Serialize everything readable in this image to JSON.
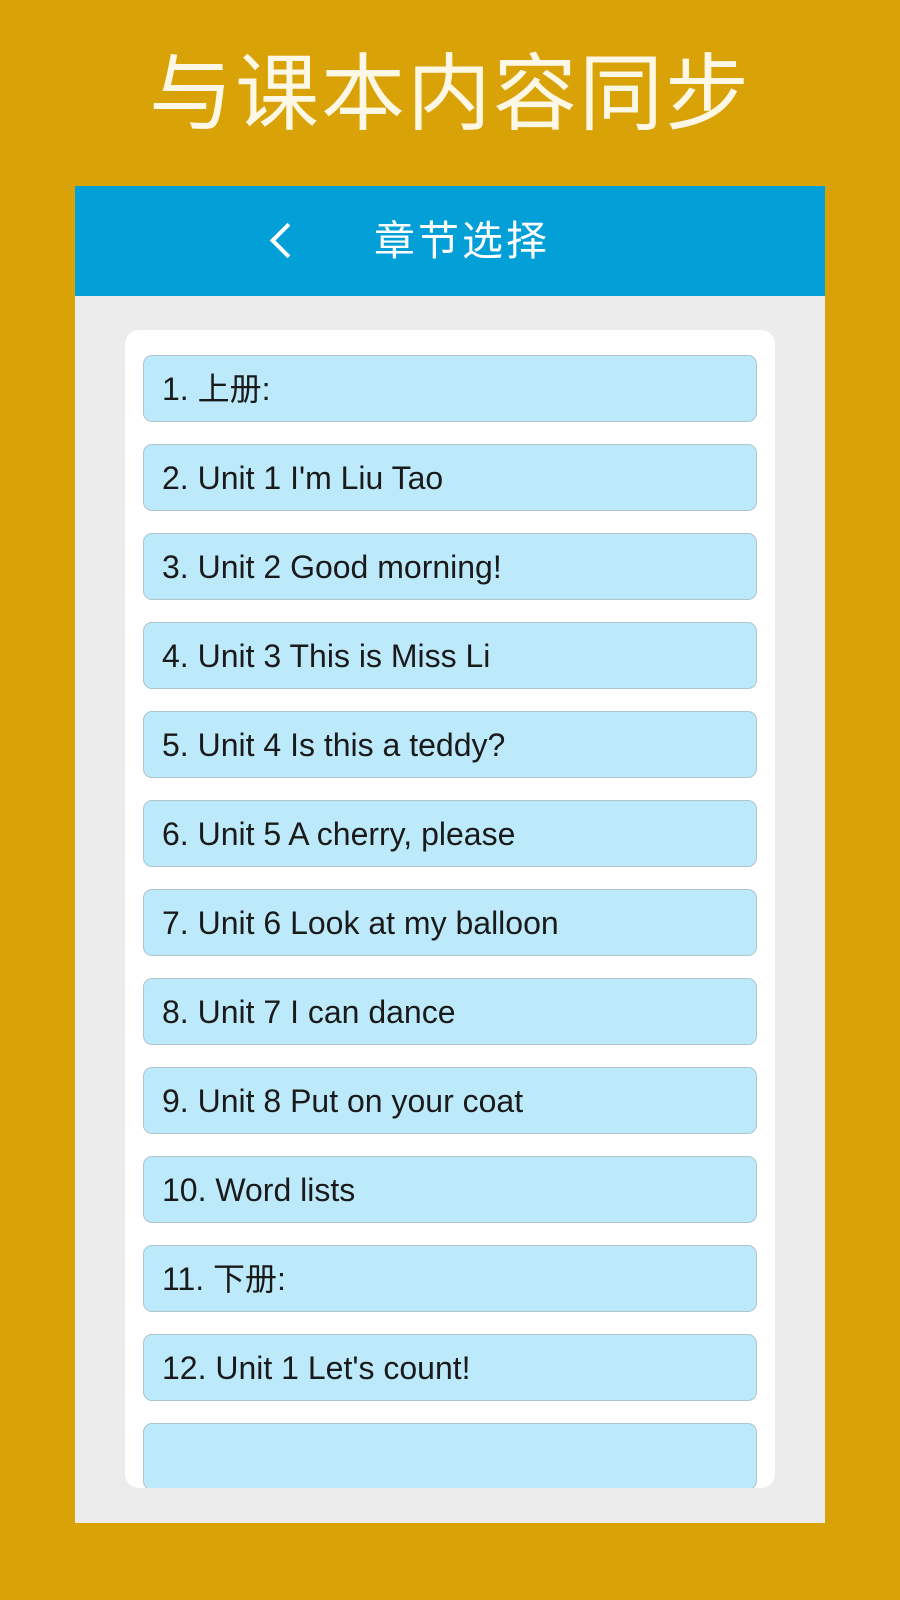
{
  "promo": {
    "headline": "与课本内容同步"
  },
  "app_bar": {
    "back_icon": "chevron-left-icon",
    "title": "章节选择"
  },
  "colors": {
    "promo_background": "#D9A206",
    "promo_text": "#FDF7E6",
    "app_bar_background": "#03A0D8",
    "app_bar_text": "#FFFFFF",
    "screen_background": "#ECECEC",
    "list_card_background": "#FFFFFF",
    "item_background": "#BDEAFB",
    "item_border": "#AFC4CE",
    "item_text": "#1A1A1A"
  },
  "chapter_list": {
    "items": [
      {
        "label": "1. 上册:"
      },
      {
        "label": "2. Unit 1 I'm Liu Tao"
      },
      {
        "label": "3. Unit 2 Good morning!"
      },
      {
        "label": "4. Unit 3 This is Miss Li"
      },
      {
        "label": "5. Unit 4 Is this a teddy?"
      },
      {
        "label": "6. Unit 5 A cherry, please"
      },
      {
        "label": "7. Unit 6 Look at my balloon"
      },
      {
        "label": "8. Unit 7 I can dance"
      },
      {
        "label": "9. Unit 8 Put on your coat"
      },
      {
        "label": "10. Word lists"
      },
      {
        "label": "11. 下册:"
      },
      {
        "label": "12. Unit 1 Let's count!"
      },
      {
        "label": ""
      }
    ]
  }
}
